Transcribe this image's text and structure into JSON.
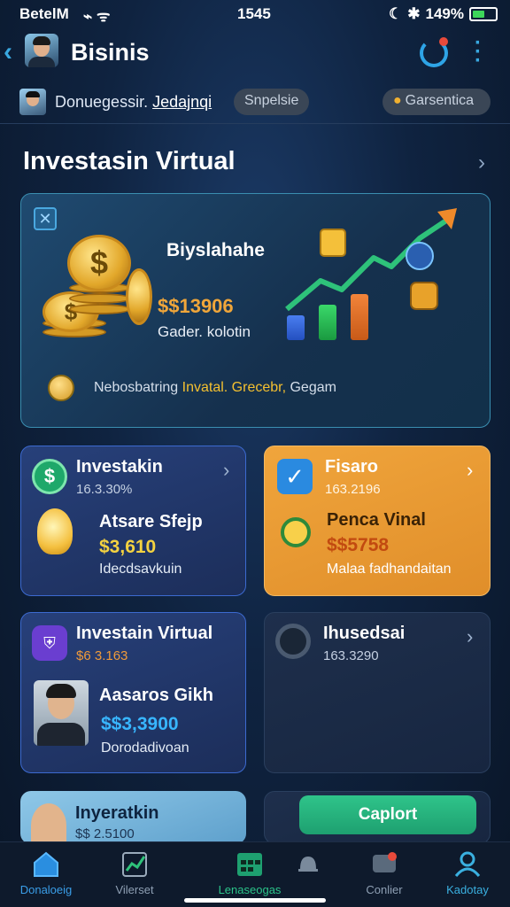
{
  "status_bar": {
    "carrier": "BetelM",
    "time": "1545",
    "battery": "149%"
  },
  "header": {
    "title": "Bisinis"
  },
  "subheader": {
    "text": "Donuegessir.",
    "link": "Jedajnqi",
    "pill_a": "Snpelsie",
    "pill_b": "Garsentica"
  },
  "section": {
    "title": "Investasin Virtual"
  },
  "hero": {
    "label": "Biyslahahe",
    "amount": "$$13906",
    "sub": "Gader. kolotin",
    "footer_a": "Nebosbatring",
    "footer_b": "Invatal.",
    "footer_c": "Grecebr,",
    "footer_d": "Gegam"
  },
  "cards": [
    {
      "title": "Investakin",
      "num": "16.3.30%",
      "mid": "Atsare Sfejp",
      "amount": "$3,610",
      "foot": "Idecdsavkuin"
    },
    {
      "title": "Fisaro",
      "num": "163.2196",
      "mid": "Penca Vinal",
      "amount": "$$5758",
      "foot": "Malaa fadhandaitan"
    },
    {
      "title": "Investain Virtual",
      "num": "$6 3.163",
      "mid": "Aasaros Gikh",
      "amount": "$$3,3900",
      "foot": "Dorodadivoan"
    },
    {
      "title": "Ihusedsai",
      "num": "163.3290"
    },
    {
      "title": "Inyeratkin",
      "num": "$$ 2.5100"
    }
  ],
  "connect_button": "Caplort",
  "nav": [
    {
      "label": "Donaloeig",
      "color": "#3a9ee8"
    },
    {
      "label": "Vilerset",
      "color": "#8fa0b4"
    },
    {
      "label": "Lenaseogas",
      "color": "#2bc48a"
    },
    {
      "label": "",
      "color": "#8fa0b4"
    },
    {
      "label": "Conlier",
      "color": "#8fa0b4"
    },
    {
      "label": "Kadotay",
      "color": "#3ab0e0"
    }
  ]
}
